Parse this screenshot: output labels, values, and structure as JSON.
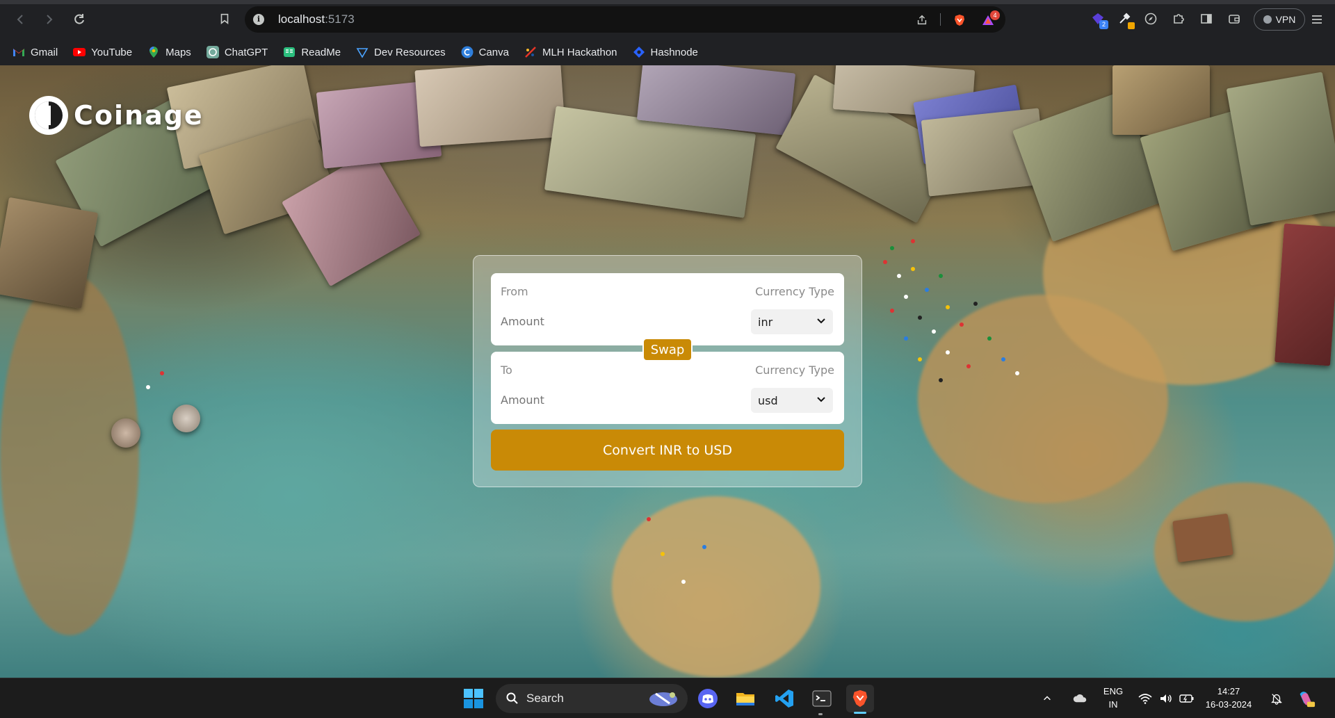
{
  "browser": {
    "url_host": "localhost",
    "url_port": ":5173",
    "notification_count": "4",
    "extension_badge": "2",
    "vpn_label": "VPN"
  },
  "bookmarks": [
    {
      "label": "Gmail",
      "icon": "gmail-icon"
    },
    {
      "label": "YouTube",
      "icon": "youtube-icon"
    },
    {
      "label": "Maps",
      "icon": "maps-icon"
    },
    {
      "label": "ChatGPT",
      "icon": "chatgpt-icon"
    },
    {
      "label": "ReadMe",
      "icon": "readme-icon"
    },
    {
      "label": "Dev Resources",
      "icon": "dev-resources-icon"
    },
    {
      "label": "Canva",
      "icon": "canva-icon"
    },
    {
      "label": "MLH Hackathon",
      "icon": "mlh-icon"
    },
    {
      "label": "Hashnode",
      "icon": "hashnode-icon"
    }
  ],
  "app": {
    "logo_text": "Coinage",
    "from_box": {
      "label": "From",
      "currency_type_label": "Currency Type",
      "amount_placeholder": "Amount",
      "selected_currency": "inr"
    },
    "to_box": {
      "label": "To",
      "currency_type_label": "Currency Type",
      "amount_placeholder": "Amount",
      "selected_currency": "usd"
    },
    "swap_label": "Swap",
    "convert_label": "Convert INR to USD",
    "accent_color": "#c98a06"
  },
  "taskbar": {
    "search_label": "Search",
    "language_line1": "ENG",
    "language_line2": "IN",
    "time": "14:27",
    "date": "16-03-2024"
  }
}
